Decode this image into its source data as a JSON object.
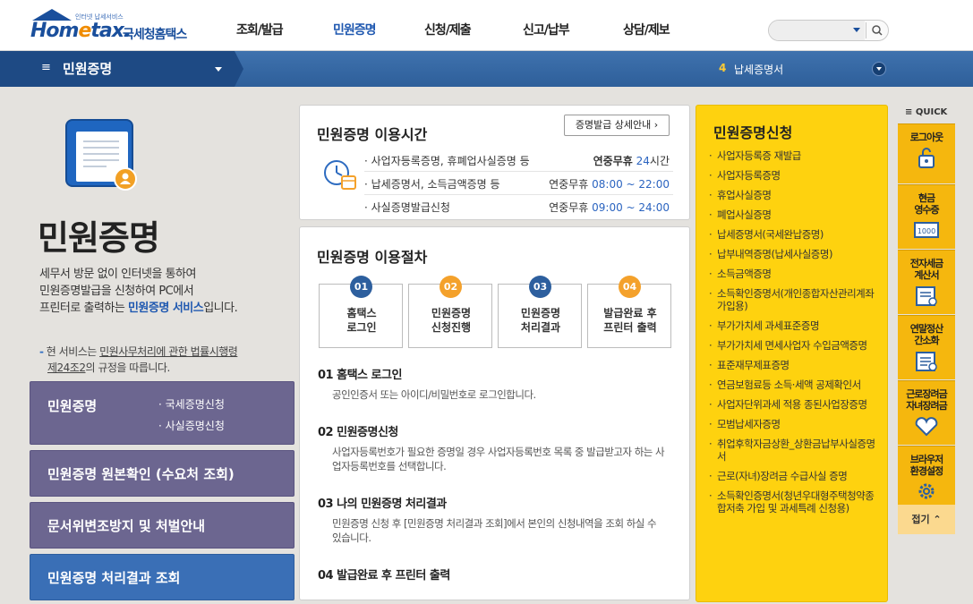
{
  "header": {
    "logo_small": "인터넷 납세서비스",
    "logo_home": "Hom",
    "logo_e": "e",
    "logo_tax": "tax.",
    "logo_korean": "국세청홈택스",
    "nav": [
      "조회/발급",
      "민원증명",
      "신청/제출",
      "신고/납부",
      "상담/제보"
    ],
    "nav_active": "민원증명",
    "search": {
      "placeholder": ""
    }
  },
  "subbar": {
    "menu_title": "민원증명",
    "right_number": "4",
    "right_label": "납세증명서"
  },
  "left": {
    "page_title": "민원증명",
    "desc_line1": "세무서 방문 없이 인터넷을 통하여",
    "desc_line2": "민원증명발급을 신청하여 PC에서",
    "desc_line3_pre": "프린터로 출력하는 ",
    "desc_line3_link": "민원증명 서비스",
    "desc_line3_post": "입니다.",
    "note_dash": "-",
    "note_pre": " 현 서비스는 ",
    "note_underline": "민원사무처리에 관한 법률시행령",
    "note_line2_underline": "제24조2",
    "note_line2_post": "의 규정을 따릅니다.",
    "buttons": [
      {
        "label": "민원증명",
        "subs": [
          "국세증명신청",
          "사실증명신청"
        ]
      },
      {
        "label": "민원증명 원본확인 (수요처 조회)"
      },
      {
        "label": "문서위변조방지 및 처벌안내"
      },
      {
        "label": "민원증명 처리결과 조회"
      }
    ]
  },
  "hours": {
    "title": "민원증명 이용시간",
    "detail_button": "증명발급 상세안내",
    "rows": [
      {
        "label": "사업자등록증명, 휴폐업사실증명 등",
        "prefix": "연중무휴",
        "time": "24",
        "suffix": "시간"
      },
      {
        "label": "납세증명서, 소득금액증명 등",
        "prefix": "연중무휴",
        "time": "08:00 ~ 22:00",
        "suffix": ""
      },
      {
        "label": "사실증명발급신청",
        "prefix": "연중무휴",
        "time": "09:00 ~ 24:00",
        "suffix": ""
      }
    ]
  },
  "procedure": {
    "title": "민원증명 이용절차",
    "steps": [
      {
        "num": "01",
        "line1": "홈택스",
        "line2": "로그인",
        "color": "#2d5f9e"
      },
      {
        "num": "02",
        "line1": "민원증명",
        "line2": "신청진행",
        "color": "#f4a12b"
      },
      {
        "num": "03",
        "line1": "민원증명",
        "line2": "처리결과",
        "color": "#2d5f9e"
      },
      {
        "num": "04",
        "line1": "발급완료 후",
        "line2": "프린터 출력",
        "color": "#f4a12b"
      }
    ],
    "details": [
      {
        "title": "01 홈택스 로그인",
        "desc": "공인인증서 또는 아이디/비밀번호로 로그인합니다."
      },
      {
        "title": "02 민원증명신청",
        "desc": "사업자등록번호가 필요한 증명일 경우 사업자등록번호 목록 중 발급받고자 하는 사업자등록번호를 선택합니다."
      },
      {
        "title": "03 나의 민원증명 처리결과",
        "desc": "민원증명 신청 후 [민원증명 처리결과 조회]에서 본인의 신청내역을 조회 하실 수 있습니다."
      },
      {
        "title": "04 발급완료 후 프린터 출력",
        "desc": ""
      }
    ]
  },
  "apply": {
    "title": "민원증명신청",
    "items": [
      "사업자등록증 재발급",
      "사업자등록증명",
      "휴업사실증명",
      "폐업사실증명",
      "납세증명서(국세완납증명)",
      "납부내역증명(납세사실증명)",
      "소득금액증명",
      "소득확인증명서(개인종합자산관리계좌 가입용)",
      "부가가치세 과세표준증명",
      "부가가치세 면세사업자 수입금액증명",
      "표준재무제표증명",
      "연금보험료등 소득·세액 공제확인서",
      "사업자단위과세 적용 종된사업장증명",
      "모범납세자증명",
      "취업후학자금상환_상환금납부사실증명서",
      "근로(자녀)장려금 수급사실 증명",
      "소득확인증명서(청년우대형주택청약종합저축 가입 및 과세특례 신청용)"
    ]
  },
  "quick": {
    "title": "QUICK",
    "items": [
      {
        "label1": "로그아웃",
        "label2": "",
        "icon": "logout-icon"
      },
      {
        "label1": "현금",
        "label2": "영수증",
        "icon": "receipt-icon"
      },
      {
        "label1": "전자세금",
        "label2": "계산서",
        "icon": "invoice-icon"
      },
      {
        "label1": "연말정산",
        "label2": "간소화",
        "icon": "yearend-icon"
      },
      {
        "label1": "근로장려금",
        "label2": "자녀장려금",
        "icon": "heart-icon"
      },
      {
        "label1": "브라우저",
        "label2": "환경설정",
        "icon": "gear-icon"
      }
    ],
    "fold": "접기"
  }
}
